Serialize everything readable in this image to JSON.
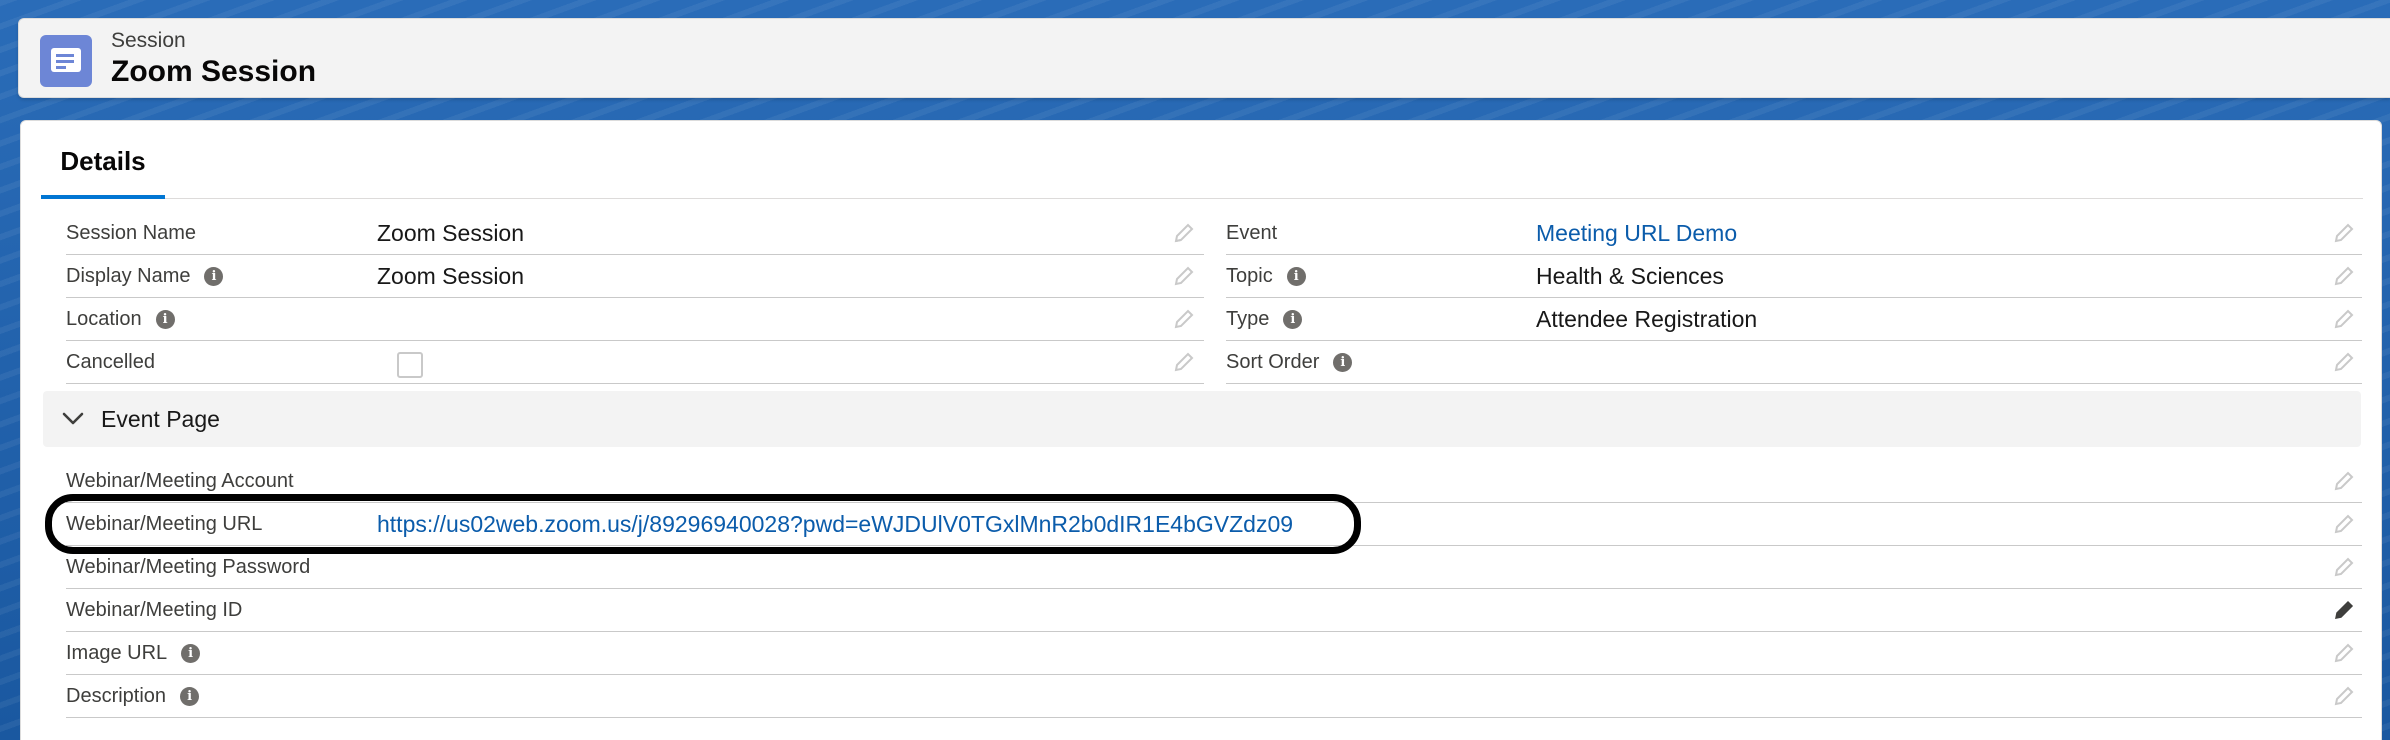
{
  "header": {
    "eyebrow": "Session",
    "title": "Zoom Session",
    "icon": "record-icon"
  },
  "tabs": [
    {
      "label": "Details",
      "active": true
    }
  ],
  "left_fields": [
    {
      "label": "Session Name",
      "value": "Zoom Session",
      "info": false
    },
    {
      "label": "Display Name",
      "value": "Zoom Session",
      "info": true
    },
    {
      "label": "Location",
      "value": "",
      "info": true
    },
    {
      "label": "Cancelled",
      "value": "",
      "info": false,
      "checkbox": true
    }
  ],
  "right_fields": [
    {
      "label": "Event",
      "value": "Meeting URL Demo",
      "info": false,
      "link": true
    },
    {
      "label": "Topic",
      "value": "Health & Sciences",
      "info": true
    },
    {
      "label": "Type",
      "value": "Attendee Registration",
      "info": true
    },
    {
      "label": "Sort Order",
      "value": "",
      "info": true
    }
  ],
  "section": {
    "title": "Event Page"
  },
  "event_fields": [
    {
      "label": "Webinar/Meeting Account",
      "value": "",
      "info": false
    },
    {
      "label": "Webinar/Meeting URL",
      "value": "https://us02web.zoom.us/j/89296940028?pwd=eWJDUlV0TGxlMnR2b0dIR1E4bGVZdz09",
      "info": false,
      "link": true
    },
    {
      "label": "Webinar/Meeting Password",
      "value": "",
      "info": false
    },
    {
      "label": "Webinar/Meeting ID",
      "value": "",
      "info": false
    },
    {
      "label": "Image URL",
      "value": "",
      "info": true
    },
    {
      "label": "Description",
      "value": "",
      "info": true
    }
  ],
  "info_glyph": "i",
  "colors": {
    "accent": "#0176d3",
    "link": "#0b5cab",
    "header_icon_bg": "#6d86d6",
    "highlight": "#000000"
  }
}
